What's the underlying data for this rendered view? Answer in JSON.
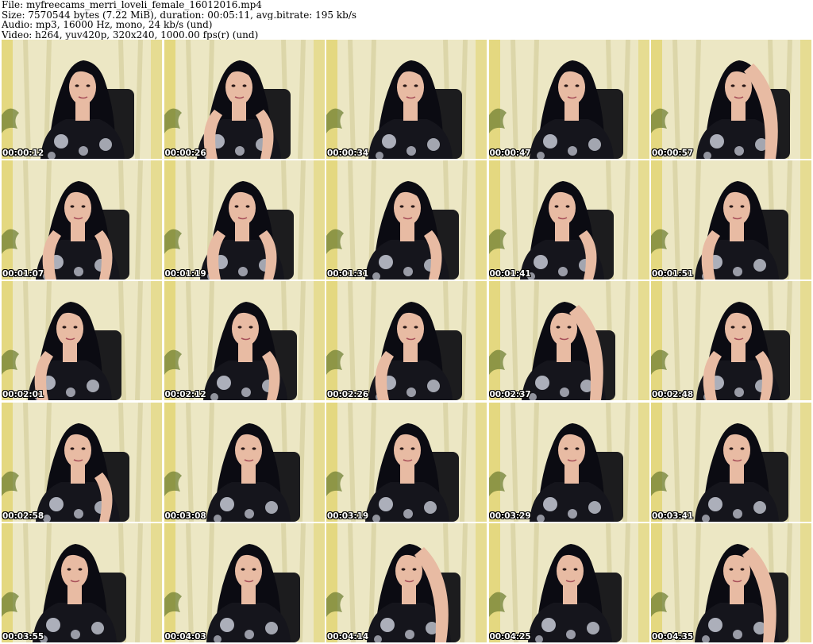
{
  "header": {
    "file_line": "File: myfreecams_merri_loveli_female_16012016.mp4",
    "size_line": "Size: 7570544 bytes (7.22 MiB), duration: 00:05:11, avg.bitrate: 195 kb/s",
    "audio_line": "Audio: mp3, 16000 Hz, mono, 24 kb/s (und)",
    "video_line": "Video: h264, yuv420p, 320x240, 1000.00 fps(r) (und)"
  },
  "thumbnails": [
    {
      "timestamp": "00:00:12"
    },
    {
      "timestamp": "00:00:26"
    },
    {
      "timestamp": "00:00:34"
    },
    {
      "timestamp": "00:00:47"
    },
    {
      "timestamp": "00:00:57"
    },
    {
      "timestamp": "00:01:07"
    },
    {
      "timestamp": "00:01:19"
    },
    {
      "timestamp": "00:01:31"
    },
    {
      "timestamp": "00:01:41"
    },
    {
      "timestamp": "00:01:51"
    },
    {
      "timestamp": "00:02:01"
    },
    {
      "timestamp": "00:02:12"
    },
    {
      "timestamp": "00:02:26"
    },
    {
      "timestamp": "00:02:37"
    },
    {
      "timestamp": "00:02:48"
    },
    {
      "timestamp": "00:02:58"
    },
    {
      "timestamp": "00:03:08"
    },
    {
      "timestamp": "00:03:19"
    },
    {
      "timestamp": "00:03:29"
    },
    {
      "timestamp": "00:03:41"
    },
    {
      "timestamp": "00:03:55"
    },
    {
      "timestamp": "00:04:03"
    },
    {
      "timestamp": "00:04:14"
    },
    {
      "timestamp": "00:04:25"
    },
    {
      "timestamp": "00:04:35"
    }
  ],
  "colors": {
    "curtain_light": "#ece7c4",
    "curtain_shadow": "#d3cc98",
    "wall_yellow": "#e2d36a",
    "chair": "#1c1c1e",
    "hair": "#0b0b12",
    "skin": "#e8bba3",
    "shirt": "#15151c",
    "flower": "#c7cad6",
    "timestamp_text": "#ffffff"
  }
}
